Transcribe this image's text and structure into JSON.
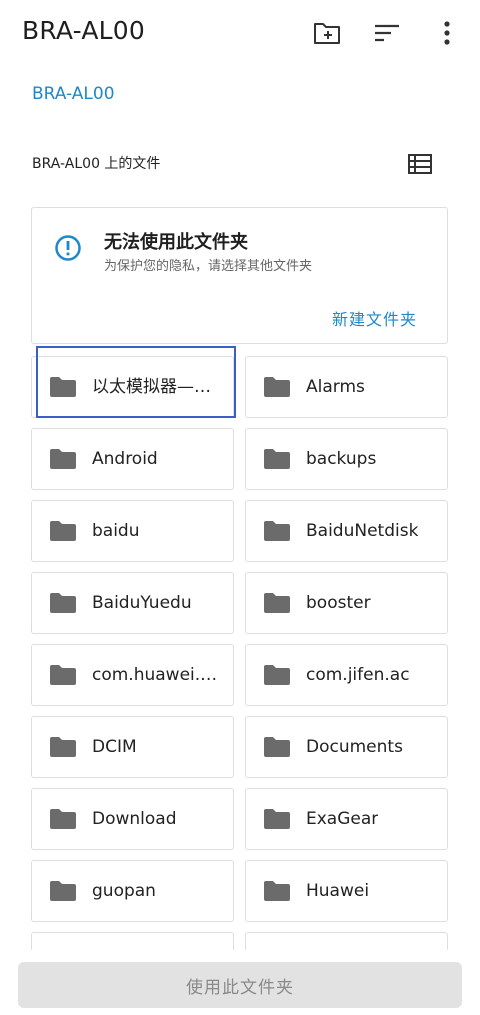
{
  "appbar": {
    "title": "BRA-AL00",
    "actions": [
      {
        "icon": "new-folder-icon"
      },
      {
        "icon": "sort-icon"
      },
      {
        "icon": "more-vert-icon"
      }
    ]
  },
  "breadcrumb": "BRA-AL00",
  "section": {
    "label": "BRA-AL00 上的文件",
    "view_icon": "list-view-icon"
  },
  "notice": {
    "icon": "info-icon",
    "title": "无法使用此文件夹",
    "subtitle": "为保护您的隐私，请选择其他文件夹",
    "action": "新建文件夹"
  },
  "folders": [
    "以太模拟器—…",
    "Alarms",
    "Android",
    "backups",
    "baidu",
    "BaiduNetdisk",
    "BaiduYuedu",
    "booster",
    "com.huawei.…",
    "com.jifen.ac",
    "DCIM",
    "Documents",
    "Download",
    "ExaGear",
    "guopan",
    "Huawei",
    "",
    ""
  ],
  "colors": {
    "accent": "#1e88c8",
    "folder": "#6b6b6b",
    "highlight": "#3a5fcb",
    "disabled_button_bg": "#e2e2e2"
  },
  "footer": {
    "use_button": "使用此文件夹"
  }
}
